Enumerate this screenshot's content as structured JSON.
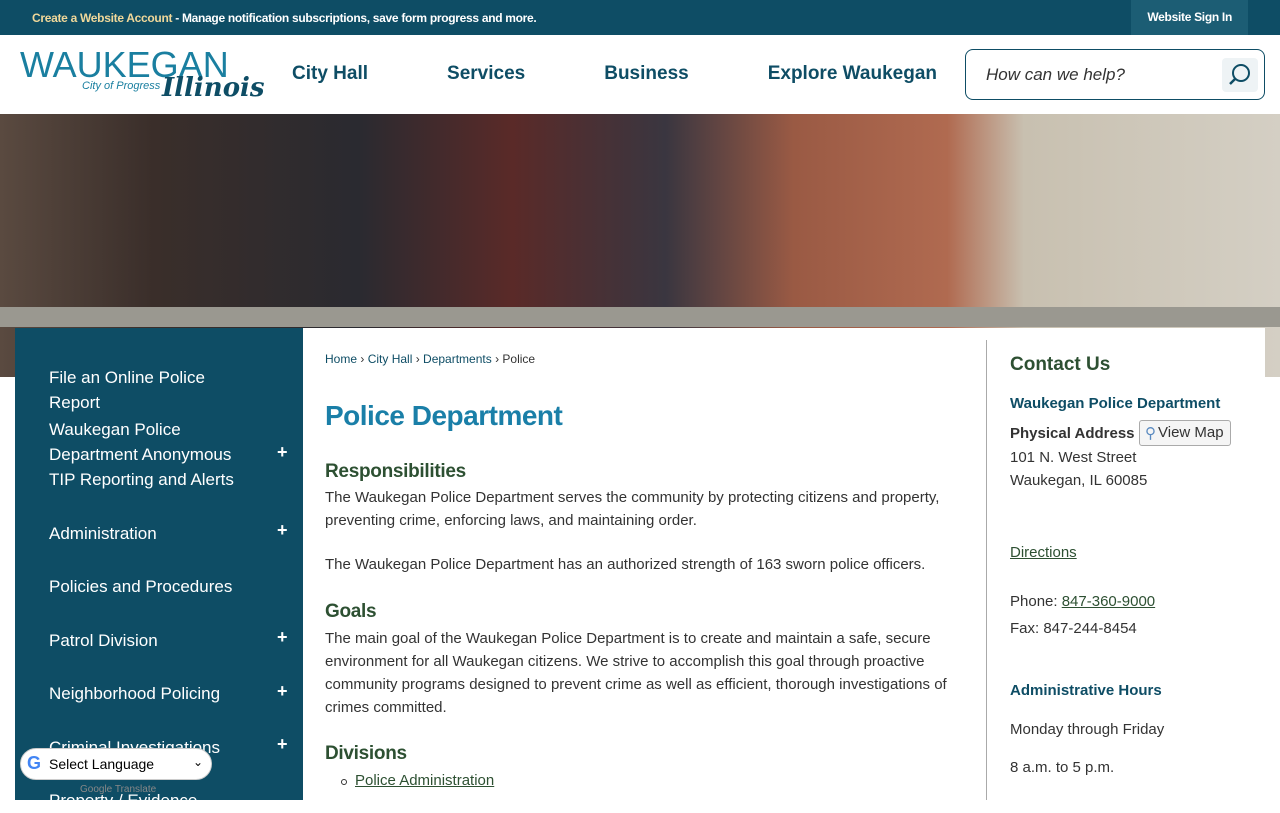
{
  "topbar": {
    "create_account": "Create a Website Account",
    "message": " - Manage notification subscriptions, save form progress and more.",
    "sign_in": "Website Sign In"
  },
  "logo": {
    "name": "WAUKEGAN",
    "tagline": "City of Progress",
    "state": "Illinois"
  },
  "nav": [
    "City Hall",
    "Services",
    "Business",
    "Explore Waukegan"
  ],
  "search": {
    "placeholder": "How can we help?",
    "icon": "search-icon"
  },
  "sidebar": [
    {
      "label": "File an Online Police Report",
      "expandable": false
    },
    {
      "label": "Waukegan Police Department Anonymous TIP Reporting and Alerts",
      "expandable": true
    },
    {
      "label": "Administration",
      "expandable": true
    },
    {
      "label": "Policies and Procedures",
      "expandable": false
    },
    {
      "label": "Patrol Division",
      "expandable": true
    },
    {
      "label": "Neighborhood Policing",
      "expandable": true
    },
    {
      "label": "Criminal Investigations",
      "expandable": true
    },
    {
      "label": "Property / Evidence",
      "expandable": false
    }
  ],
  "plus": "+",
  "breadcrumb": [
    "Home",
    "City Hall",
    "Departments",
    "Police"
  ],
  "sep": " › ",
  "main": {
    "title": "Police Department",
    "h_resp": "Responsibilities",
    "p1": "The Waukegan Police Department serves the community by protecting citizens and property, preventing crime, enforcing laws, and maintaining order.",
    "p2": "The Waukegan Police Department has an authorized strength of 163 sworn police officers.",
    "h_goals": "Goals",
    "p3": "The main goal of the Waukegan Police Department is to create and maintain a safe, secure environment for all Waukegan citizens. We strive to accomplish this goal through proactive community programs designed to prevent crime as well as efficient, thorough investigations of crimes committed.",
    "h_div": "Divisions",
    "div1": "Police Administration"
  },
  "contact": {
    "title": "Contact Us",
    "dept": "Waukegan Police Department",
    "addr_label": "Physical Address",
    "view_map": "View Map",
    "addr1": "101 N. West Street",
    "addr2": "Waukegan, IL 60085",
    "directions": "Directions",
    "phone_label": "Phone: ",
    "phone": "847-360-9000",
    "fax": "Fax: 847-244-8454",
    "hours_title": "Administrative Hours",
    "days": "Monday through Friday",
    "hours": "8 a.m. to 5 p.m."
  },
  "translate": {
    "label": "Select Language",
    "powered": "Google Translate"
  }
}
